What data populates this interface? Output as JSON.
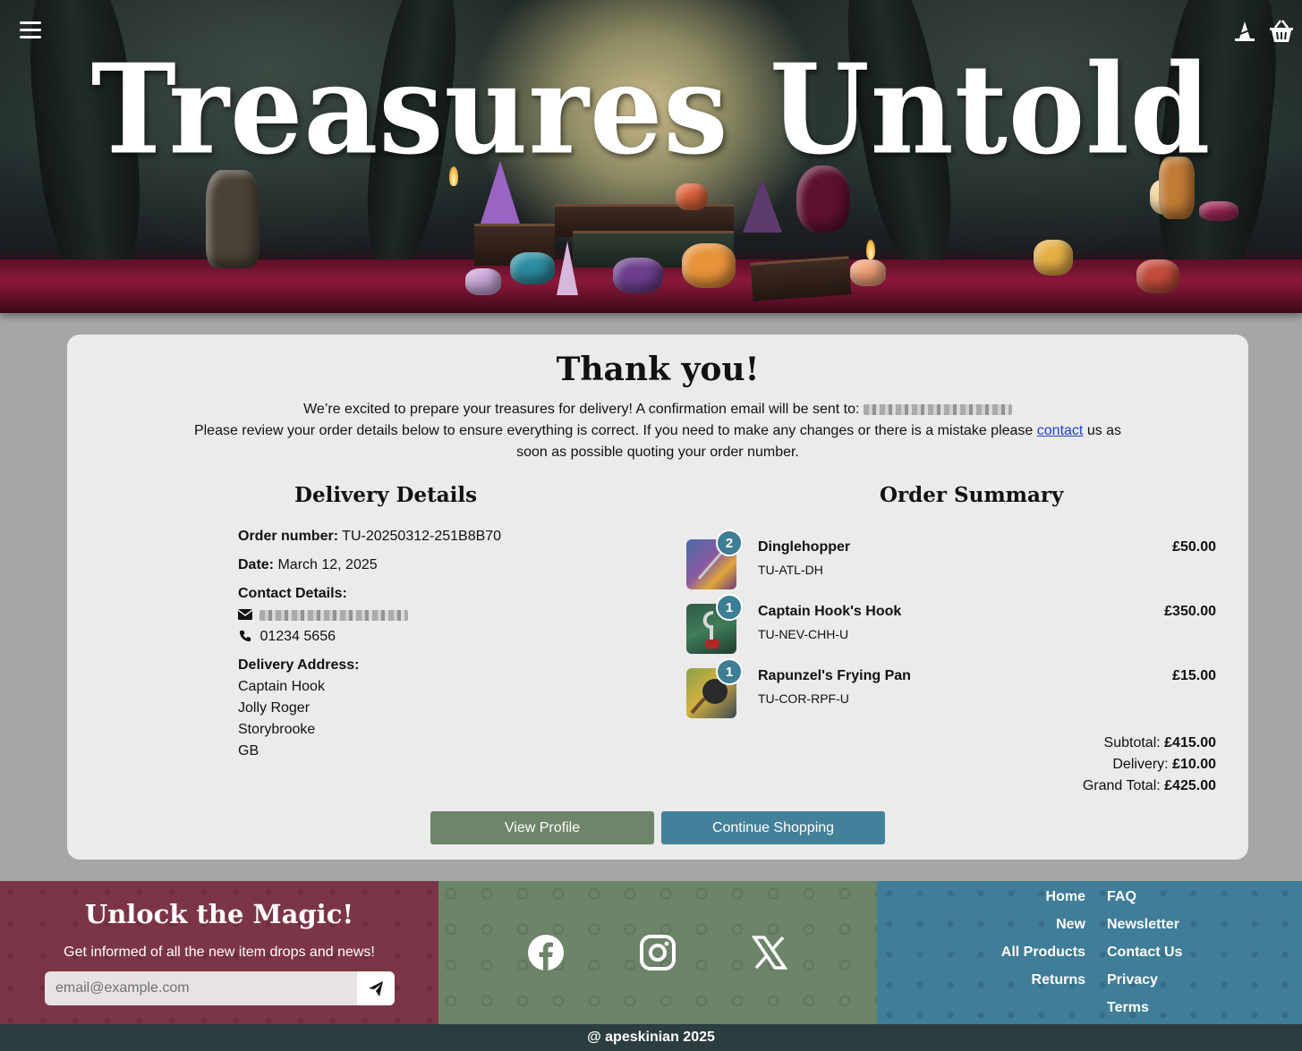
{
  "header": {
    "title": "Treasures Untold",
    "menu_icon": "hamburger-menu-icon",
    "account_icon": "wizard-hat-icon",
    "cart_icon": "basket-icon"
  },
  "confirmation": {
    "title": "Thank you!",
    "line1": "We’re excited to prepare your treasures for delivery! A confirmation email will be sent to:",
    "line2_before": "Please review your order details below to ensure everything is correct. If you need to make any changes or there is a mistake please",
    "contact_link": "contact",
    "line2_after": "us as soon as possible quoting your order number."
  },
  "delivery": {
    "heading": "Delivery Details",
    "order_number_label": "Order number:",
    "order_number": "TU-20250312-251B8B70",
    "date_label": "Date:",
    "date": "March 12, 2025",
    "contact_label": "Contact Details:",
    "phone": "01234 5656",
    "address_label": "Delivery Address:",
    "address": [
      "Captain Hook",
      "Jolly Roger",
      "Storybrooke",
      "GB"
    ]
  },
  "order": {
    "heading": "Order Summary",
    "items": [
      {
        "name": "Dinglehopper",
        "sku": "TU-ATL-DH",
        "qty": "2",
        "price": "£50.00"
      },
      {
        "name": "Captain Hook's Hook",
        "sku": "TU-NEV-CHH-U",
        "qty": "1",
        "price": "£350.00"
      },
      {
        "name": "Rapunzel's Frying Pan",
        "sku": "TU-COR-RPF-U",
        "qty": "1",
        "price": "£15.00"
      }
    ],
    "subtotal_label": "Subtotal:",
    "subtotal": "£415.00",
    "delivery_label": "Delivery:",
    "delivery": "£10.00",
    "grand_total_label": "Grand Total:",
    "grand_total": "£425.00"
  },
  "buttons": {
    "view_profile": "View Profile",
    "continue_shopping": "Continue Shopping"
  },
  "footer": {
    "newsletter_title": "Unlock the Magic!",
    "newsletter_sub": "Get informed of all the new item drops and news!",
    "email_placeholder": "email@example.com",
    "social": [
      "facebook-icon",
      "instagram-icon",
      "x-icon"
    ],
    "links_left": [
      "Home",
      "New",
      "All Products",
      "Returns"
    ],
    "links_right": [
      "FAQ",
      "Newsletter",
      "Contact Us",
      "Privacy",
      "Terms"
    ],
    "copyright": "@ apeskinian 2025"
  },
  "colors": {
    "card_bg": "#ebebeb",
    "profile_button": "#6e8569",
    "shop_button": "#43809a",
    "qty_badge": "#3d7d96",
    "footer_left": "#7c3447",
    "footer_mid": "#6c8468",
    "footer_right": "#3f7d98",
    "bottom_bar": "#2c3d3f"
  }
}
